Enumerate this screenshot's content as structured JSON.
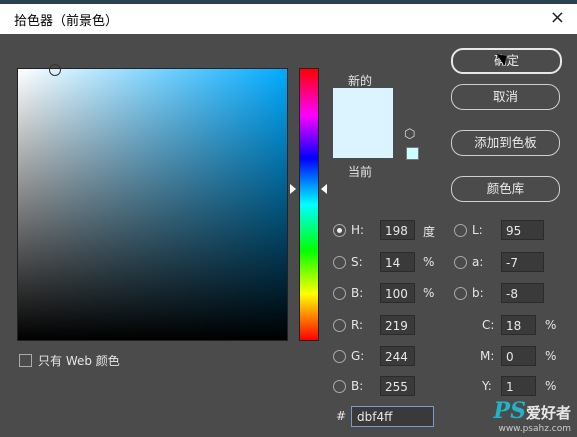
{
  "window": {
    "title": "拾色器（前景色）",
    "close_icon": "×"
  },
  "preview": {
    "new_label": "新的",
    "current_label": "当前",
    "new_color": "#dbf4ff",
    "current_color": "#dbf4ff",
    "websafe_color": "#ccffff"
  },
  "buttons": {
    "ok": "确定",
    "cancel": "取消",
    "add_swatch": "添加到色板",
    "libraries": "颜色库"
  },
  "hsb": {
    "h": {
      "label": "H:",
      "value": "198",
      "unit": "度",
      "selected": true
    },
    "s": {
      "label": "S:",
      "value": "14",
      "unit": "%"
    },
    "b": {
      "label": "B:",
      "value": "100",
      "unit": "%"
    }
  },
  "lab": {
    "l": {
      "label": "L:",
      "value": "95"
    },
    "a": {
      "label": "a:",
      "value": "-7"
    },
    "b": {
      "label": "b:",
      "value": "-8"
    }
  },
  "rgb": {
    "r": {
      "label": "R:",
      "value": "219"
    },
    "g": {
      "label": "G:",
      "value": "244"
    },
    "b": {
      "label": "B:",
      "value": "255"
    }
  },
  "cmyk": {
    "c": {
      "label": "C:",
      "value": "18",
      "unit": "%"
    },
    "m": {
      "label": "M:",
      "value": "0",
      "unit": "%"
    },
    "y": {
      "label": "Y:",
      "value": "1",
      "unit": "%"
    }
  },
  "hex": {
    "prefix": "#",
    "value": "dbf4ff"
  },
  "web_only": {
    "label": "只有 Web 颜色",
    "checked": false
  },
  "watermark": {
    "brand": "PS",
    "text": "爱好者",
    "url": "www.psahz.com"
  }
}
